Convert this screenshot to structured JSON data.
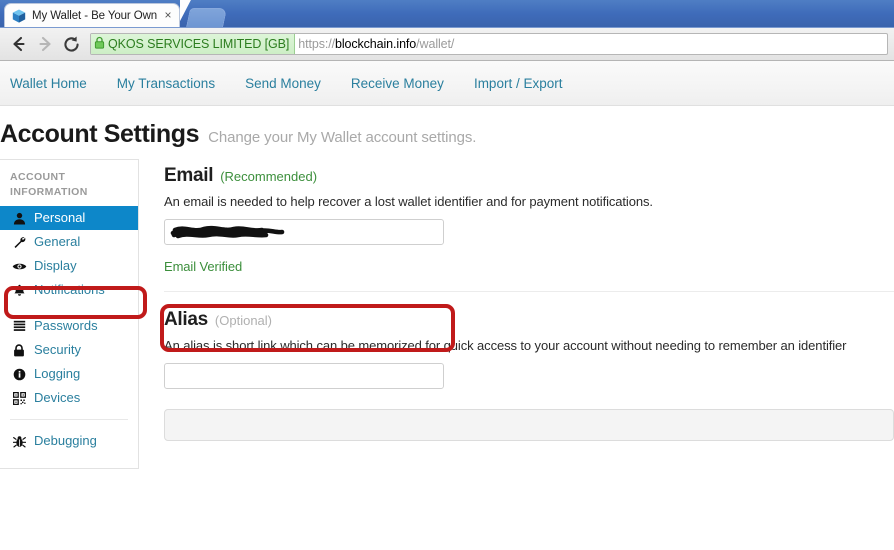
{
  "browser": {
    "tab": {
      "title": "My Wallet - Be Your Own Bar",
      "favicon_name": "wallet-cube-favicon",
      "close_label": "×"
    },
    "newtab_label": "",
    "toolbar": {
      "back_label": "←",
      "forward_label": "→",
      "reload_label": "⟳",
      "ev_certificate": "QKOS SERVICES LIMITED [GB]",
      "url_scheme": "https://",
      "url_host": "blockchain.info",
      "url_path": "/wallet/"
    }
  },
  "site_nav": {
    "items": [
      {
        "label": "Wallet Home"
      },
      {
        "label": "My Transactions"
      },
      {
        "label": "Send Money"
      },
      {
        "label": "Receive Money"
      },
      {
        "label": "Import / Export"
      }
    ]
  },
  "header": {
    "title": "Account Settings",
    "subtitle": "Change your My Wallet account settings."
  },
  "sidebar": {
    "heading": "ACCOUNT INFORMATION",
    "items": [
      {
        "label": "Personal",
        "icon": "user-icon",
        "active": true
      },
      {
        "label": "General",
        "icon": "wrench-icon",
        "active": false
      },
      {
        "label": "Display",
        "icon": "eye-icon",
        "active": false
      },
      {
        "label": "Notifications",
        "icon": "bell-icon",
        "active": false
      },
      {
        "label": "Passwords",
        "icon": "list-lines-icon",
        "active": false
      },
      {
        "label": "Security",
        "icon": "lock-icon",
        "active": false
      },
      {
        "label": "Logging",
        "icon": "info-circle-icon",
        "active": false
      },
      {
        "label": "Devices",
        "icon": "qrcode-icon",
        "active": false
      },
      {
        "label": "Debugging",
        "icon": "bug-icon",
        "active": false
      }
    ]
  },
  "main": {
    "email_section": {
      "title": "Email",
      "tag": "(Recommended)",
      "description": "An email is needed to help recover a lost wallet identifier and for payment notifications.",
      "input_value": "",
      "input_placeholder": "",
      "value_redacted": true,
      "status": "Email Verified"
    },
    "alias_section": {
      "title": "Alias",
      "tag": "(Optional)",
      "description": "An alias is short link which can be memorized for quick access to your account without needing to remember an identifier",
      "input_value": "",
      "input_placeholder": ""
    }
  },
  "annotations": {
    "color": "#c01a1a",
    "boxes": [
      {
        "name": "personal-highlight"
      },
      {
        "name": "email-field-highlight"
      }
    ]
  },
  "colors": {
    "accent_blue": "#0d87c9",
    "link_teal": "#2a7f9e",
    "green": "#3c8f3c",
    "annotation_red": "#c01a1a"
  }
}
